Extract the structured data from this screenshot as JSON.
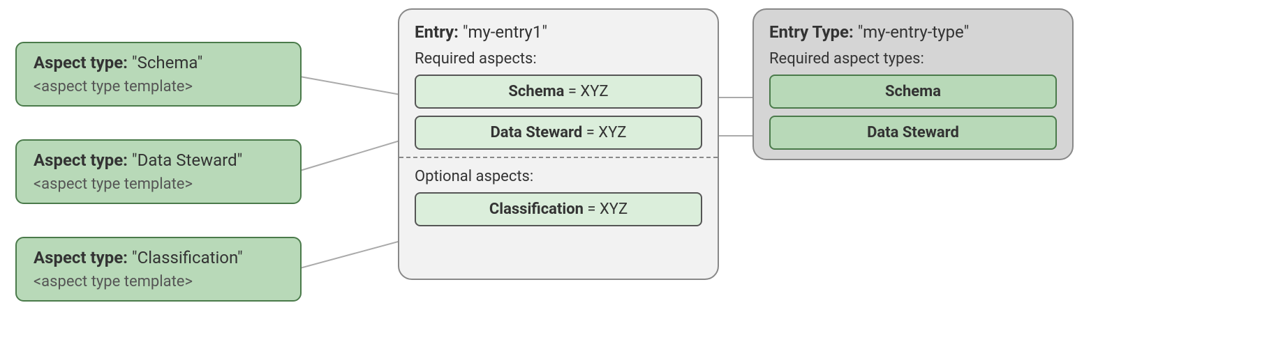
{
  "aspect_types": [
    {
      "label_prefix": "Aspect type:",
      "name": "\"Schema\"",
      "template": "<aspect type template>"
    },
    {
      "label_prefix": "Aspect type:",
      "name": "\"Data Steward\"",
      "template": "<aspect type template>"
    },
    {
      "label_prefix": "Aspect type:",
      "name": "\"Classification\"",
      "template": "<aspect type template>"
    }
  ],
  "entry": {
    "title_prefix": "Entry:",
    "title_name": "\"my-entry1\"",
    "required_label": "Required aspects:",
    "required": [
      {
        "name": "Schema",
        "value": "XYZ"
      },
      {
        "name": "Data Steward",
        "value": "XYZ"
      }
    ],
    "optional_label": "Optional aspects:",
    "optional": [
      {
        "name": "Classification",
        "value": "XYZ"
      }
    ]
  },
  "entry_type": {
    "title_prefix": "Entry Type:",
    "title_name": "\"my-entry-type\"",
    "required_label": "Required aspect types:",
    "required": [
      {
        "name": "Schema"
      },
      {
        "name": "Data Steward"
      }
    ]
  }
}
